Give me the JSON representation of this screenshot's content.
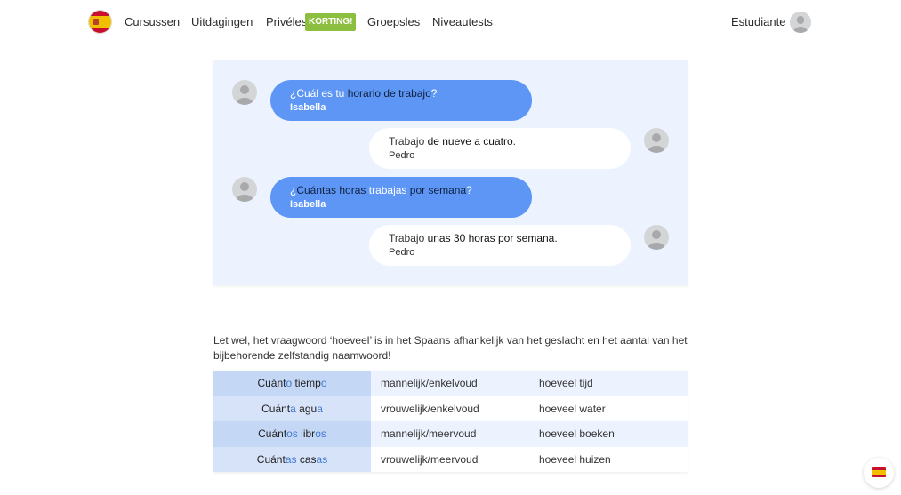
{
  "nav": {
    "logo_icon": "spain-flag-icon",
    "items": [
      {
        "label": "Cursussen"
      },
      {
        "label": "Uitdagingen"
      },
      {
        "label": "Privéles"
      },
      {
        "label": "Groepsles"
      },
      {
        "label": "Niveautests"
      }
    ],
    "badge": "KORTING!",
    "badge_color": "#8cbf3f",
    "user_name": "Estudiante",
    "user_avatar_icon": "user-avatar-icon"
  },
  "dialog": {
    "colors": {
      "background": "#ecf3fe",
      "left_bubble": "#5d96f5",
      "right_bubble": "#ffffff"
    },
    "messages": [
      {
        "side": "left",
        "parts": [
          {
            "text": "¿Cuál es tu ",
            "hl": false
          },
          {
            "text": "horario de trabajo",
            "hl": true
          },
          {
            "text": "?",
            "hl": false
          }
        ],
        "speaker": "Isabella"
      },
      {
        "side": "right",
        "parts": [
          {
            "text": "Trabajo ",
            "hl": false
          },
          {
            "text": "de nueve a cuatro",
            "hl": true
          },
          {
            "text": ".",
            "hl": false
          }
        ],
        "speaker": "Pedro"
      },
      {
        "side": "left",
        "parts": [
          {
            "text": "¿",
            "hl": false
          },
          {
            "text": "Cuántas horas ",
            "hl": true
          },
          {
            "text": "trabajas",
            "hl": false
          },
          {
            "text": " por semana",
            "hl": true
          },
          {
            "text": "?",
            "hl": false
          }
        ],
        "speaker": "Isabella"
      },
      {
        "side": "right",
        "parts": [
          {
            "text": "Trabajo ",
            "hl": false
          },
          {
            "text": "unas 30 horas por semana",
            "hl": true
          },
          {
            "text": ".",
            "hl": false
          }
        ],
        "speaker": "Pedro"
      }
    ]
  },
  "note": {
    "text": "Let wel, het vraagwoord ‘hoeveel’ is in het Spaans afhankelijk van het  geslacht en het aantal van het bijbehorende zelfstandig naamwoord!"
  },
  "table": {
    "rows": [
      {
        "es": [
          {
            "t": "Cuánt",
            "s": false
          },
          {
            "t": "o",
            "s": true
          },
          {
            "t": " tiemp",
            "s": false
          },
          {
            "t": "o",
            "s": true
          }
        ],
        "form": "mannelijk/enkelvoud",
        "nl": "hoeveel tijd"
      },
      {
        "es": [
          {
            "t": "Cuánt",
            "s": false
          },
          {
            "t": "a",
            "s": true
          },
          {
            "t": " agu",
            "s": false
          },
          {
            "t": "a",
            "s": true
          }
        ],
        "form": "vrouwelijk/enkelvoud",
        "nl": "hoeveel water"
      },
      {
        "es": [
          {
            "t": "Cuánt",
            "s": false
          },
          {
            "t": "os",
            "s": true
          },
          {
            "t": " libr",
            "s": false
          },
          {
            "t": "os",
            "s": true
          }
        ],
        "form": "mannelijk/meervoud",
        "nl": "hoeveel boeken"
      },
      {
        "es": [
          {
            "t": "Cuánt",
            "s": false
          },
          {
            "t": "as",
            "s": true
          },
          {
            "t": " cas",
            "s": false
          },
          {
            "t": "as",
            "s": true
          }
        ],
        "form": "vrouwelijk/meervoud",
        "nl": "hoeveel huizen"
      }
    ],
    "suffix_color": "#3f7ad6"
  },
  "lang_button": {
    "icon": "spain-flag-icon"
  }
}
